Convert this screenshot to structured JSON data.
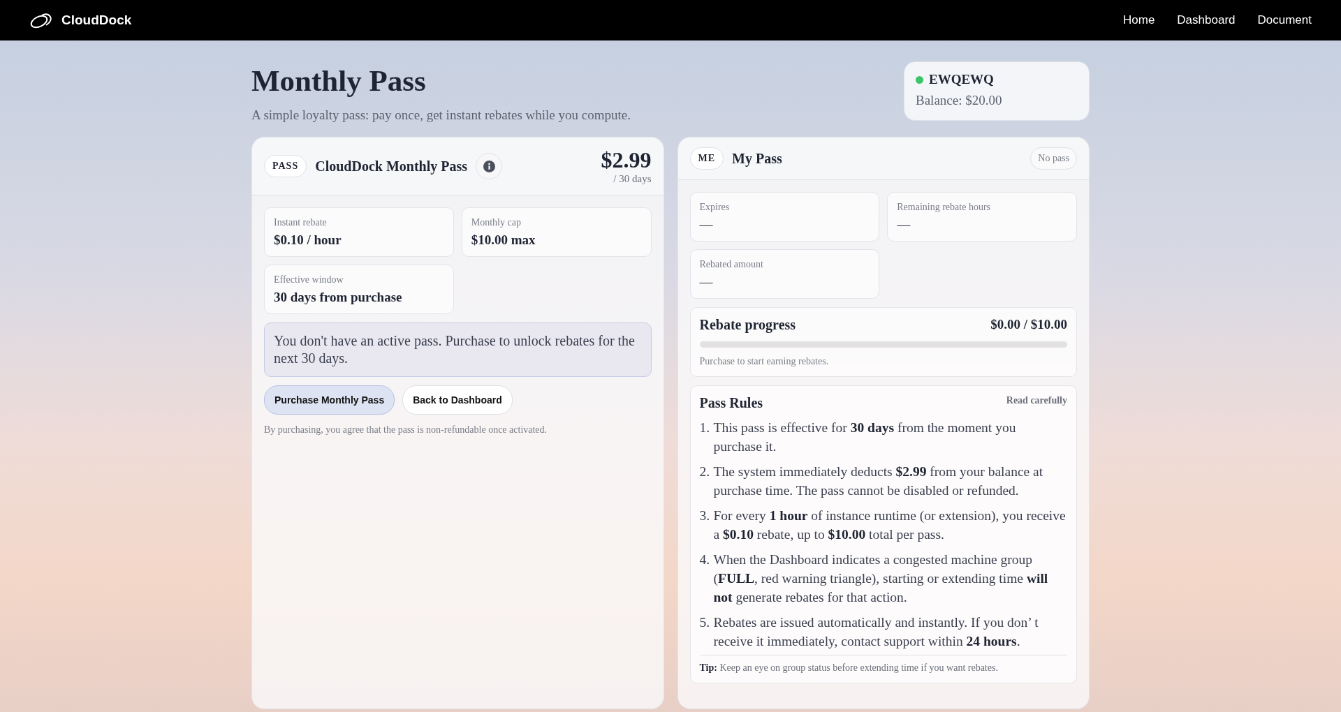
{
  "navbar": {
    "brand": "CloudDock",
    "links": [
      "Home",
      "Dashboard",
      "Document"
    ]
  },
  "page": {
    "title": "Monthly Pass",
    "subtitle": "A simple loyalty pass: pay once, get instant rebates while you compute."
  },
  "account": {
    "name": "EWQEWQ",
    "color": "#3cc46a",
    "balance": "Balance: $20.00"
  },
  "pass_card": {
    "badge": "PASS",
    "name": "CloudDock Monthly Pass",
    "price": "$2.99",
    "period": "/ 30 days",
    "facts": [
      {
        "label": "Instant rebate",
        "value": "$0.10 / hour"
      },
      {
        "label": "Monthly cap",
        "value": "$10.00 max"
      },
      {
        "label": "Effective window",
        "value": "30 days from purchase"
      }
    ],
    "notice": "You don't have an active pass. Purchase to unlock rebates for the next 30 days.",
    "buttons": [
      {
        "label": "Purchase Monthly Pass",
        "kind": "primary"
      },
      {
        "label": "Back to Dashboard",
        "kind": "secondary"
      }
    ],
    "disclaimer": "By purchasing, you agree that the pass is non-refundable once activated."
  },
  "my_pass": {
    "badge": "ME",
    "title": "My Pass",
    "status": "No pass",
    "stats": [
      {
        "label": "Expires",
        "value": "—"
      },
      {
        "label": "Remaining rebate hours",
        "value": "—"
      },
      {
        "label": "Rebated amount",
        "value": "—"
      }
    ],
    "progress": {
      "title": "Rebate progress",
      "reading": "$0.00 / $10.00",
      "level": 0,
      "hint": "Purchase to start earning rebates."
    },
    "rules": {
      "title": "Pass Rules",
      "note": "Read carefully",
      "items": [
        {
          "number": "1.",
          "text": "This pass is effective for **30 days** from the moment you purchase it."
        },
        {
          "number": "2.",
          "text": "The system immediately deducts **$2.99** from your balance at purchase time. The pass cannot be disabled or refunded."
        },
        {
          "number": "3.",
          "text": "For every **1 hour** of instance runtime (or extension), you receive a **$0.10** rebate, up to **$10.00** total per pass."
        },
        {
          "number": "4.",
          "text": "When the Dashboard indicates a congested machine group (**FULL**, red warning triangle), starting or extending time **will not** generate rebates for that action."
        },
        {
          "number": "5.",
          "text": "Rebates are issued automatically and instantly. If you don’ t receive it immediately, contact support within **24 hours**."
        }
      ],
      "tip_label": "Tip:",
      "tip": "Keep an eye on group status before extending time if you want rebates."
    }
  }
}
